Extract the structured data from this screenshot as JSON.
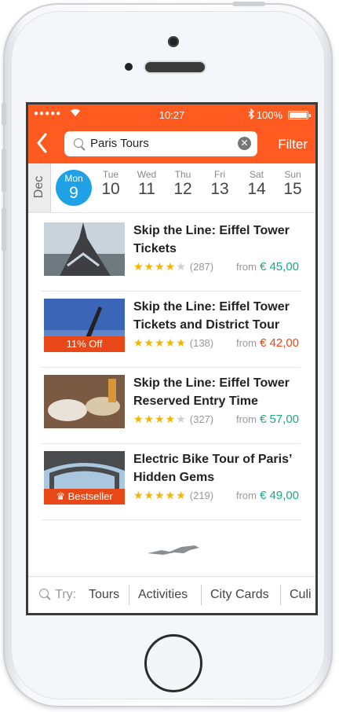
{
  "status": {
    "time": "10:27",
    "battery": "100%",
    "signal": "●●●●●"
  },
  "navbar": {
    "search_value": "Paris Tours",
    "filter_label": "Filter"
  },
  "calendar": {
    "month": "Dec",
    "days": [
      {
        "weekday": "Mon",
        "day": "9"
      },
      {
        "weekday": "Tue",
        "day": "10"
      },
      {
        "weekday": "Wed",
        "day": "11"
      },
      {
        "weekday": "Thu",
        "day": "12"
      },
      {
        "weekday": "Fri",
        "day": "13"
      },
      {
        "weekday": "Sat",
        "day": "14"
      },
      {
        "weekday": "Sun",
        "day": "15"
      }
    ]
  },
  "results": [
    {
      "title": "Skip the Line: Eiffel Tower Tickets",
      "rating": 4,
      "reviews": "(287)",
      "from": "from",
      "price": "€ 45,00",
      "badge": ""
    },
    {
      "title": "Skip the Line: Eiffel Tower Tickets and District Tour",
      "rating": 5,
      "reviews": "(138)",
      "from": "from",
      "price": "€ 42,00",
      "badge": "11% Off"
    },
    {
      "title": "Skip the Line: Eiffel Tower Reserved Entry Time",
      "rating": 4,
      "reviews": "(327)",
      "from": "from",
      "price": "€ 57,00",
      "badge": ""
    },
    {
      "title": "Electric Bike Tour of Paris’ Hidden Gems",
      "rating": 5,
      "reviews": "(219)",
      "from": "from",
      "price": "€ 49,00",
      "badge": "Bestseller"
    }
  ],
  "bottom_bar": {
    "try_label": "Try:",
    "chips": [
      "Tours",
      "Activities",
      "City Cards",
      "Culi"
    ]
  },
  "colors": {
    "brand": "#ff5a1f",
    "accent_blue": "#1ea1e5",
    "price_green": "#19a889",
    "sale_red": "#e84817",
    "star": "#f5b400"
  }
}
